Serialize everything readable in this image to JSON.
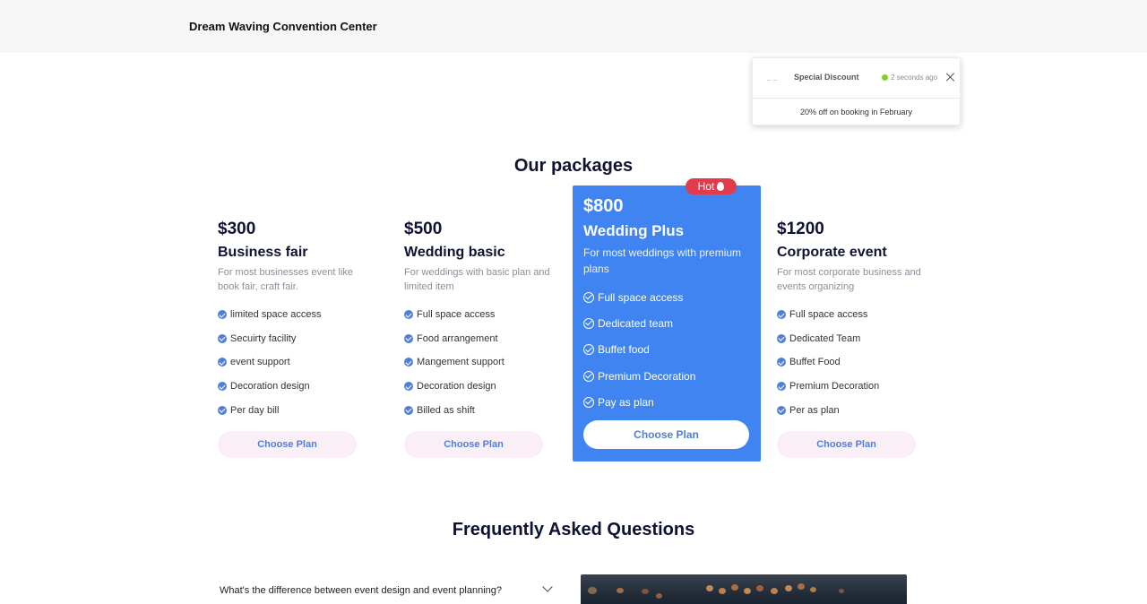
{
  "header": {
    "brand": "Dream Waving Convention Center"
  },
  "notification": {
    "title": "Special Discount",
    "time": "2 seconds ago",
    "message": "20% off on booking in February",
    "status_color": "#7ed321"
  },
  "packages": {
    "heading": "Our packages",
    "plans": [
      {
        "price": "$300",
        "name": "Business fair",
        "description": "For most businesses event like book fair, craft fair.",
        "features": [
          "limited space access",
          "Secuirty facility",
          "event support",
          "Decoration design",
          "Per day bill"
        ],
        "cta": "Choose Plan"
      },
      {
        "price": "$500",
        "name": "Wedding basic",
        "description": "For weddings with basic plan and limited item",
        "features": [
          "Full space access",
          "Food arrangement",
          "Mangement support",
          "Decoration design",
          "Billed as shift"
        ],
        "cta": "Choose Plan"
      },
      {
        "price": "$800",
        "name": "Wedding Plus",
        "description": "For most weddings with premium plans",
        "badge": "Hot",
        "features": [
          "Full space access",
          "Dedicated team",
          "Buffet food",
          "Premium Decoration",
          "Pay as plan"
        ],
        "cta": "Choose Plan"
      },
      {
        "price": "$1200",
        "name": "Corporate event",
        "description": "For most corporate business and events organizing",
        "features": [
          "Full space access",
          "Dedicated Team",
          "Buffet Food",
          "Premium Decoration",
          "Per as plan"
        ],
        "cta": "Choose Plan"
      }
    ]
  },
  "faq": {
    "heading": "Frequently Asked Questions",
    "items": [
      {
        "question": "What's the difference between event design and event planning?"
      }
    ]
  },
  "colors": {
    "accent": "#3f84f1",
    "hot_badge": "#e23b4c",
    "button_bg": "#fbeff7",
    "button_text": "#4f7fd8"
  }
}
